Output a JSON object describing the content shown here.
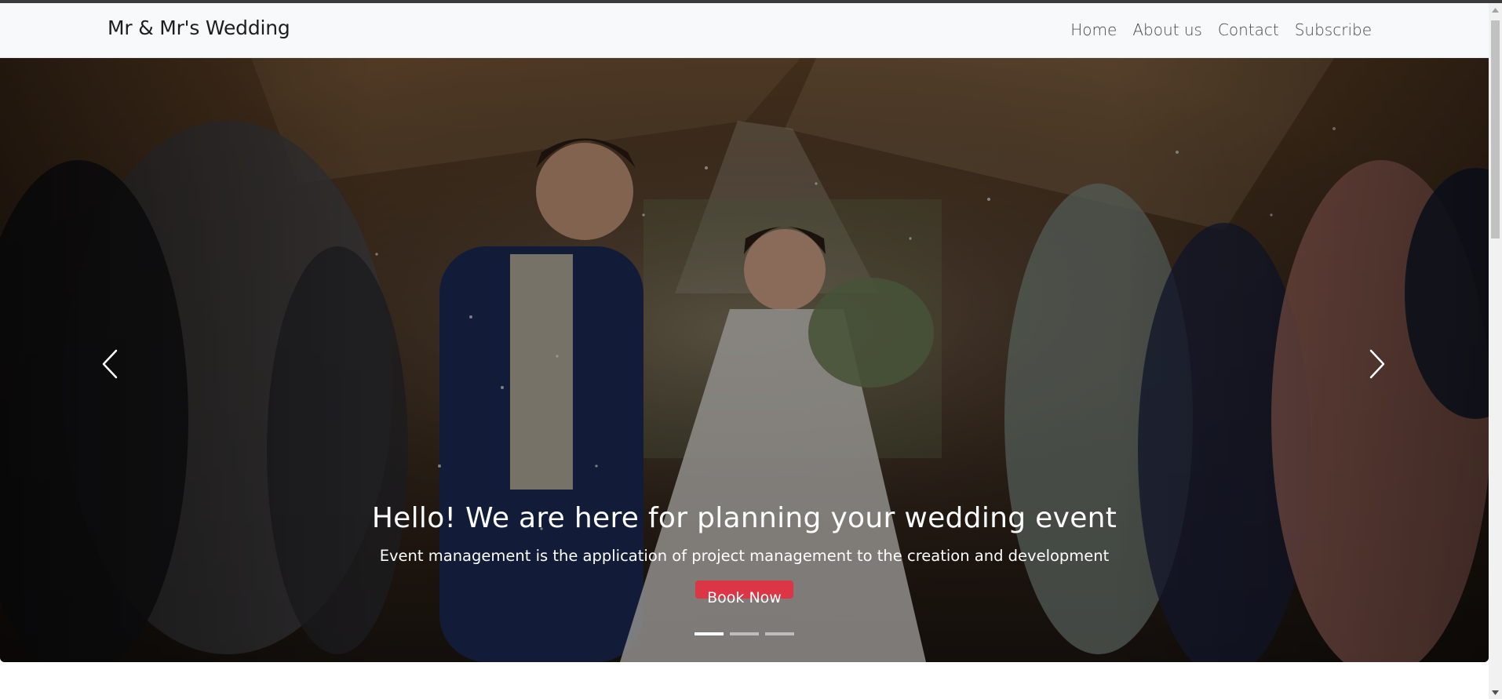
{
  "navbar": {
    "brand": "Mr & Mr's Wedding",
    "links": [
      "Home",
      "About us",
      "Contact",
      "Subscribe"
    ]
  },
  "hero": {
    "heading": "Hello! We are here for planning your wedding event",
    "subtext": "Event management is the application of project management to the creation and development",
    "button_label": "Book Now",
    "slide_count": 3,
    "active_slide": 1,
    "prev_icon": "chevron-left-icon",
    "next_icon": "chevron-right-icon",
    "image": "wedding-couple-confetti-photo"
  },
  "colors": {
    "navbar_bg": "#f8f9fa",
    "button": "#dc3545",
    "text_light": "#ffffff"
  }
}
